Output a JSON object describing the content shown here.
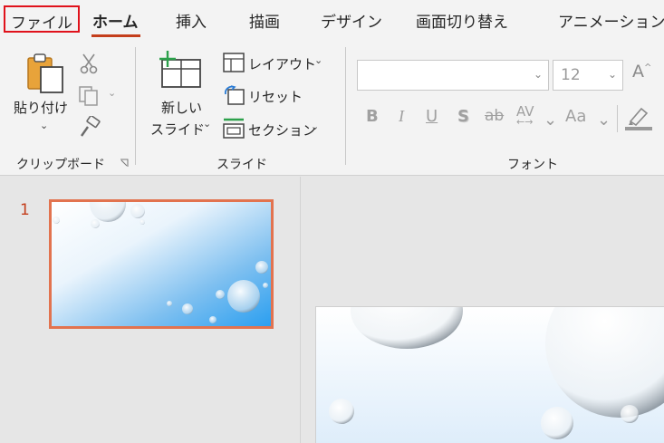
{
  "tabs": {
    "file": "ファイル",
    "home": "ホーム",
    "insert": "挿入",
    "draw": "描画",
    "design": "デザイン",
    "transitions": "画面切り替え",
    "animations": "アニメーション"
  },
  "clipboard": {
    "paste_line1": "貼り付け",
    "group_label": "クリップボード"
  },
  "slides": {
    "new_slide_line1": "新しい",
    "new_slide_line2": "スライド",
    "layout": "レイアウト",
    "reset": "リセット",
    "section": "セクション",
    "group_label": "スライド"
  },
  "font": {
    "font_name": "",
    "font_size": "12",
    "bold": "B",
    "italic": "I",
    "underline": "U",
    "shadow": "S",
    "strike": "ab",
    "spacing": "AV",
    "case": "Aa",
    "grow": "A",
    "group_label": "フォント"
  },
  "thumbnails": [
    {
      "number": "1"
    }
  ],
  "colors": {
    "accent": "#c43e1c",
    "selection_border": "#e2734f",
    "file_highlight": "#e0121b"
  }
}
